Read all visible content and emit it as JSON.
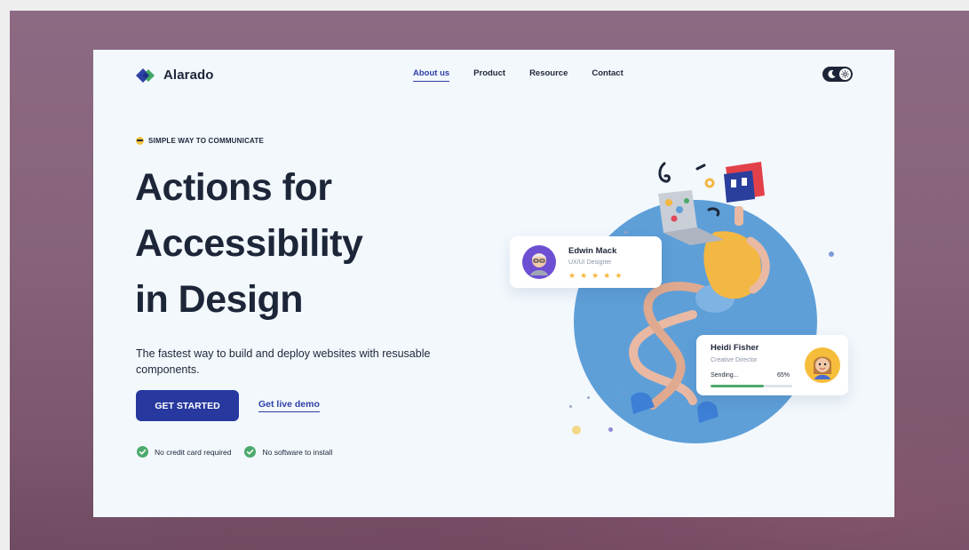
{
  "brand": {
    "name": "Alarado",
    "colors": {
      "primary": "#27389e",
      "dark": "#1d2638",
      "accent_green": "#4daa6c",
      "blob": "#5e9fd8"
    }
  },
  "nav": {
    "items": [
      {
        "label": "About us",
        "active": true
      },
      {
        "label": "Product",
        "active": false
      },
      {
        "label": "Resource",
        "active": false
      },
      {
        "label": "Contact",
        "active": false
      }
    ]
  },
  "theme_toggle": {
    "icons": [
      "moon-icon",
      "sun-icon"
    ]
  },
  "hero": {
    "tagline": "SIMPLE WAY TO COMMUNICATE",
    "headline": [
      "Actions for",
      "Accessibility",
      "in Design"
    ],
    "subtext": "The fastest way to build and deploy websites with resusable components.",
    "cta_primary": "GET STARTED",
    "cta_secondary": "Get live demo",
    "checks": [
      "No credit card required",
      "No software to install"
    ]
  },
  "cards": {
    "edwin": {
      "name": "Edwin Mack",
      "role": "UX/UI Designer",
      "rating": 5
    },
    "heidi": {
      "name": "Heidi Fisher",
      "role": "Creative Director",
      "status": "Sending...",
      "progress_pct": 65,
      "progress_text": "65%"
    }
  }
}
